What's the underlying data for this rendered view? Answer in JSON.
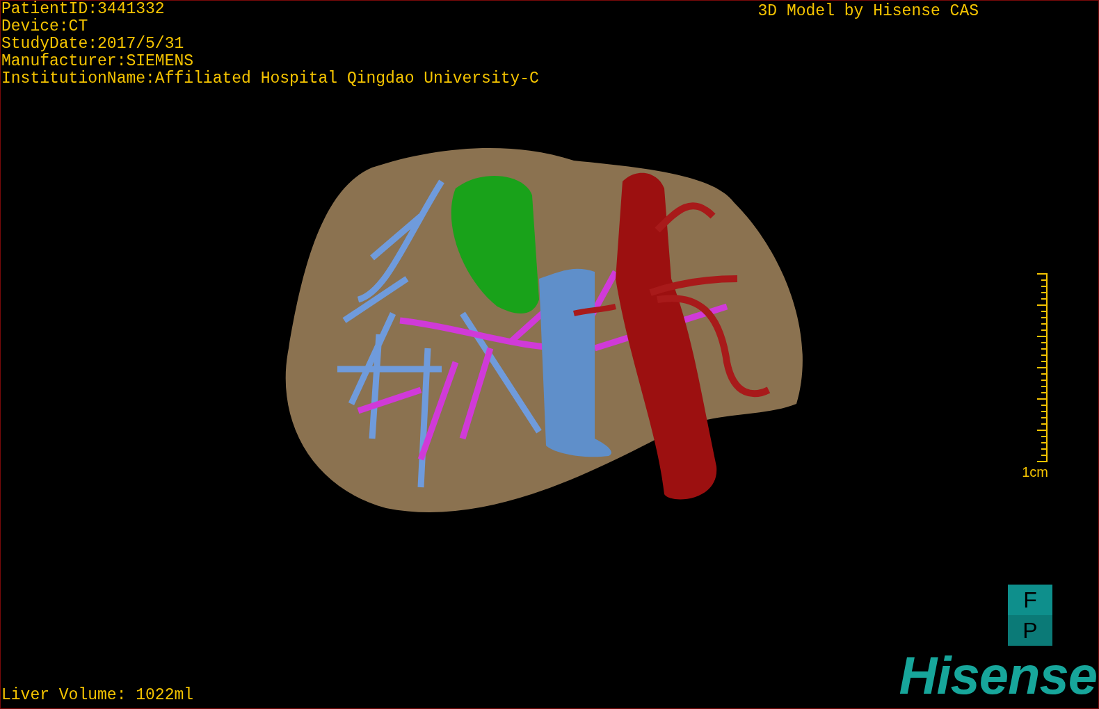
{
  "header": {
    "info_lines": [
      "PatientID:3441332",
      "Device:CT",
      "StudyDate:2017/5/31",
      "Manufacturer:SIEMENS",
      "InstitutionName:Affiliated Hospital Qingdao University-C"
    ],
    "title": "3D Model by Hisense CAS"
  },
  "scale_bar": {
    "label": "1cm"
  },
  "orientation_marker": [
    "F",
    "P"
  ],
  "footer": {
    "volume": "Liver Volume: 1022ml",
    "logo": "Hisense"
  }
}
